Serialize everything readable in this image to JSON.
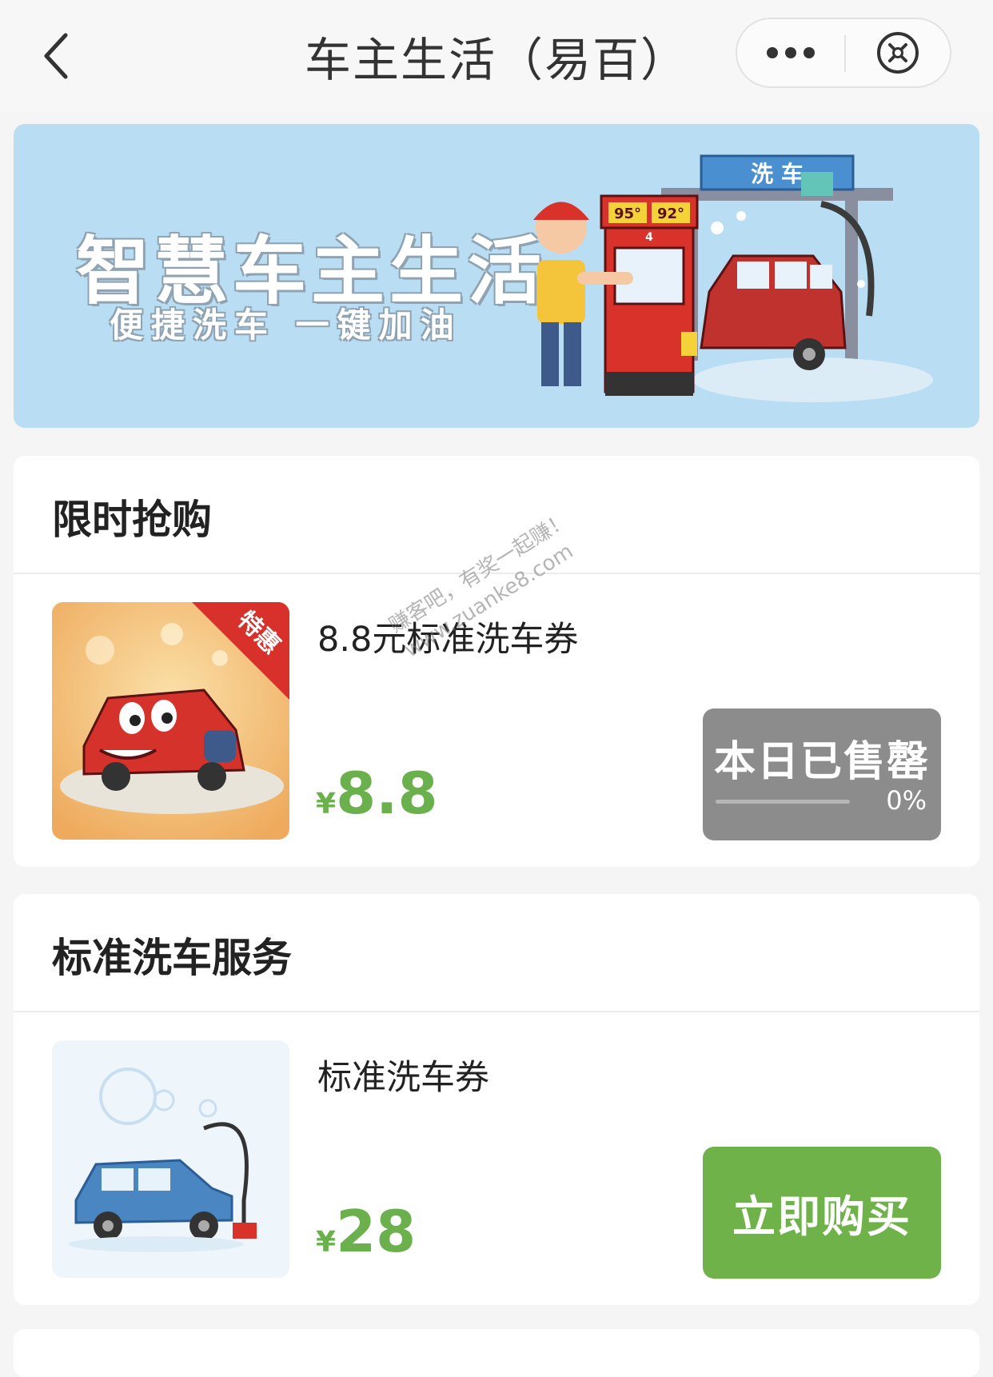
{
  "nav": {
    "title": "车主生活（易百）",
    "back_icon": "chevron-left-icon",
    "more_icon": "ellipsis-icon",
    "close_icon": "close-circle-icon"
  },
  "banner": {
    "title": "智慧车主生活",
    "subtitle": "便捷洗车  一键加油",
    "art_labels": {
      "car_wash_sign": "洗 车",
      "pump_grade_1": "95°",
      "pump_grade_2": "92°",
      "pump_number": "4"
    }
  },
  "flash_sale": {
    "header": "限时抢购",
    "item": {
      "tag": "特惠",
      "name": "8.8元标准洗车券",
      "price_symbol": "¥",
      "price": "8.8",
      "button_label": "本日已售罄",
      "progress_text": "0%",
      "progress": 0
    }
  },
  "standard_wash": {
    "header": "标准洗车服务",
    "item": {
      "name": "标准洗车券",
      "price_symbol": "¥",
      "price": "28",
      "button_label": "立即购买"
    }
  },
  "watermark": {
    "line1": "赚客吧，有奖一起赚！",
    "line2": "www.zuanke8.com"
  },
  "colors": {
    "accent_green": "#6fb24a",
    "price_green": "#6ab04c",
    "soldout_gray": "#8c8c8c",
    "banner_bg": "#b9def3"
  }
}
